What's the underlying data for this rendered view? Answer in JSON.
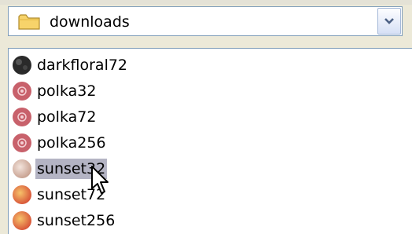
{
  "folder_combo": {
    "value": "downloads",
    "icon": "folder-icon",
    "dropdown_icon": "chevron-down-icon"
  },
  "files": [
    {
      "name": "darkfloral72",
      "icon": "dark-swatch-icon",
      "selected": false
    },
    {
      "name": "polka32",
      "icon": "polka-swatch-icon",
      "selected": false
    },
    {
      "name": "polka72",
      "icon": "polka-swatch-icon",
      "selected": false
    },
    {
      "name": "polka256",
      "icon": "polka-swatch-icon",
      "selected": false
    },
    {
      "name": "sunset32",
      "icon": "sunset-swatch-icon",
      "selected": true
    },
    {
      "name": "sunset72",
      "icon": "sunset-swatch-icon",
      "selected": false
    },
    {
      "name": "sunset256",
      "icon": "sunset-swatch-icon",
      "selected": false
    }
  ],
  "colors": {
    "selection": "#b4b4c4",
    "border": "#7f9db9",
    "folder": "#f0c44a"
  }
}
